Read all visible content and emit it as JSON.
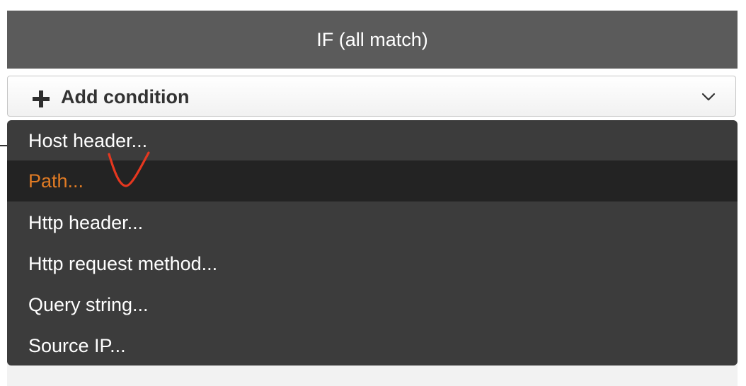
{
  "header": {
    "title": "IF (all match)"
  },
  "add_condition": {
    "label": "Add condition",
    "icon": "plus-icon",
    "dropdown_icon": "chevron-down-icon"
  },
  "dropdown": {
    "items": [
      {
        "label": "Host header..."
      },
      {
        "label": "Path...",
        "selected": true
      },
      {
        "label": "Http header..."
      },
      {
        "label": "Http request method..."
      },
      {
        "label": "Query string..."
      },
      {
        "label": "Source IP..."
      }
    ]
  },
  "colors": {
    "header_bg": "#5b5b5b",
    "menu_bg": "#3c3c3c",
    "menu_selected_bg": "#232323",
    "selected_text": "#e07b24",
    "annotation_mark": "#e5371f"
  }
}
